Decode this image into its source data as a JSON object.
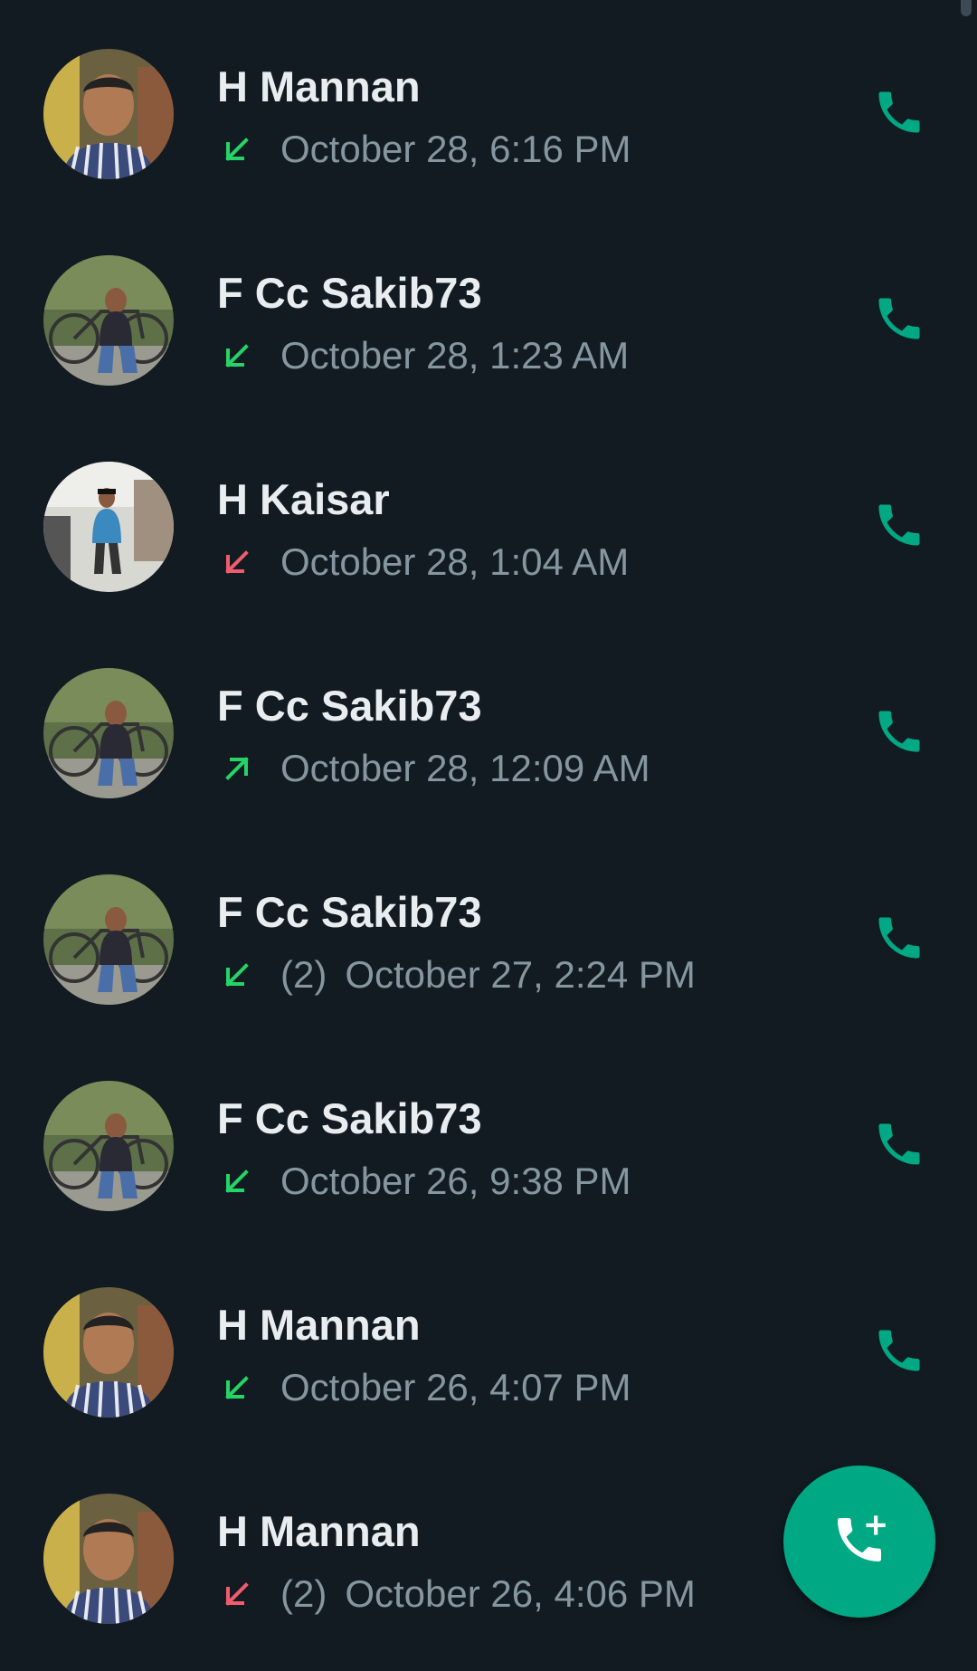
{
  "calls": [
    {
      "name": "H Mannan",
      "direction": "incoming",
      "count": "",
      "time": "October 28, 6:16 PM",
      "avatar": "portrait"
    },
    {
      "name": "F Cc Sakib73",
      "direction": "incoming",
      "count": "",
      "time": "October 28, 1:23 AM",
      "avatar": "bicycle"
    },
    {
      "name": "H Kaisar",
      "direction": "missed",
      "count": "",
      "time": "October 28, 1:04 AM",
      "avatar": "street"
    },
    {
      "name": "F Cc Sakib73",
      "direction": "outgoing",
      "count": "",
      "time": "October 28, 12:09 AM",
      "avatar": "bicycle"
    },
    {
      "name": "F Cc Sakib73",
      "direction": "incoming",
      "count": "(2)",
      "time": "October 27, 2:24 PM",
      "avatar": "bicycle"
    },
    {
      "name": "F Cc Sakib73",
      "direction": "incoming",
      "count": "",
      "time": "October 26, 9:38 PM",
      "avatar": "bicycle"
    },
    {
      "name": "H Mannan",
      "direction": "incoming",
      "count": "",
      "time": "October 26, 4:07 PM",
      "avatar": "portrait"
    },
    {
      "name": "H Mannan",
      "direction": "missed",
      "count": "(2)",
      "time": "October 26, 4:06 PM",
      "avatar": "portrait"
    }
  ],
  "icons": {
    "call_button": "phone-icon",
    "fab": "add-call-icon",
    "incoming": "arrow-down-left-icon",
    "outgoing": "arrow-up-right-icon",
    "missed": "arrow-down-left-icon"
  },
  "colors": {
    "background": "#111b21",
    "accent": "#00a884",
    "incoming": "#25d366",
    "missed": "#f15c6d",
    "name_text": "#e9edef",
    "meta_text": "#8696a0"
  }
}
